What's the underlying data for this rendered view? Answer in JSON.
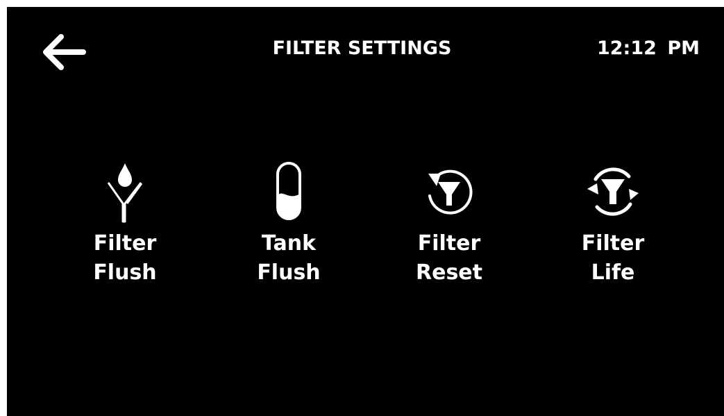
{
  "header": {
    "back_icon": "arrow-left-icon",
    "title": "FILTER SETTINGS",
    "time": "12:12 PM"
  },
  "tiles": [
    {
      "icon": "filter-flush-icon",
      "line1": "Filter",
      "line2": "Flush"
    },
    {
      "icon": "tank-flush-icon",
      "line1": "Tank",
      "line2": "Flush"
    },
    {
      "icon": "filter-reset-icon",
      "line1": "Filter",
      "line2": "Reset"
    },
    {
      "icon": "filter-life-icon",
      "line1": "Filter",
      "line2": "Life"
    }
  ],
  "colors": {
    "background": "#000000",
    "foreground": "#ffffff",
    "frame": "#ffffff"
  }
}
